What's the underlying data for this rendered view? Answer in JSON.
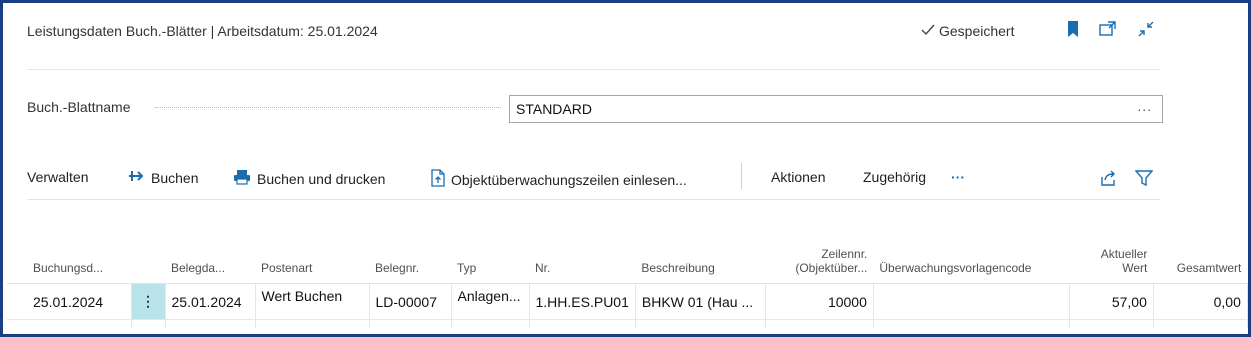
{
  "header": {
    "title": "Leistungsdaten Buch.-Blätter | Arbeitsdatum: 25.01.2024",
    "saved_label": "Gespeichert",
    "saved_icon": "checkmark-icon",
    "icons": [
      "bookmark-icon",
      "open-in-new-window-icon",
      "collapse-icon"
    ]
  },
  "journal": {
    "label": "Buch.-Blattname",
    "value": "STANDARD",
    "more": "..."
  },
  "toolbar": {
    "manage": "Verwalten",
    "post": "Buchen",
    "post_print": "Buchen und drucken",
    "read_lines": "Objektüberwachungszeilen einlesen...",
    "actions": "Aktionen",
    "related": "Zugehörig",
    "more": "···"
  },
  "table": {
    "headers": {
      "posting_date": "Buchungsd...",
      "doc_date": "Belegda...",
      "entry_type": "Postenart",
      "doc_no": "Belegnr.",
      "type": "Typ",
      "no": "Nr.",
      "description": "Beschreibung",
      "line_no_1": "Zeilennr.",
      "line_no_2": "(Objektüber...",
      "template_code": "Überwachungsvorlagencode",
      "current_1": "Aktueller",
      "current_2": "Wert",
      "total": "Gesamtwert"
    },
    "rows": [
      {
        "posting_date": "25.01.2024",
        "menu": "⋮",
        "doc_date": "25.01.2024",
        "entry_type": "Wert Buchen",
        "doc_no": "LD-00007",
        "type": "Anlagen...",
        "no": "1.HH.ES.PU01",
        "description": "BHKW 01 (Hau ...",
        "line_no": "10000",
        "template_code": "",
        "current": "57,00",
        "total": "0,00"
      }
    ]
  },
  "colors": {
    "frame": "#1a3e82",
    "accent": "#1b6dae",
    "selected_cell": "#b9e3ea"
  }
}
